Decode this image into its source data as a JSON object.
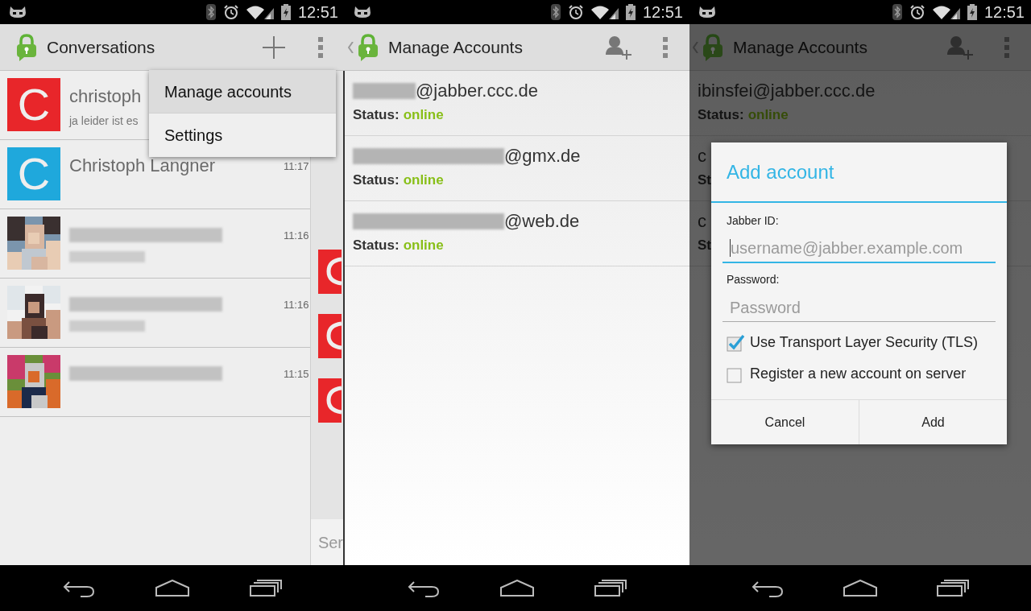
{
  "screens": [
    {
      "status_bar": {
        "time": "12:51"
      },
      "action_bar": {
        "up_caret": false,
        "title": "Conversations",
        "actions": [
          {
            "kind": "plus"
          },
          {
            "kind": "overflow"
          }
        ]
      },
      "conversations": [
        {
          "kind": "letter",
          "letter": "C",
          "color": "#e8262a",
          "name": "christoph",
          "preview": "ja leider ist es"
        },
        {
          "kind": "letter",
          "letter": "C",
          "color": "#1fa8dc",
          "name": "Christoph Langner",
          "time": "11:17"
        },
        {
          "kind": "blurred",
          "preview_blurred": true,
          "time": "11:16"
        },
        {
          "kind": "blurred",
          "preview_blurred": true,
          "time": "11:16"
        },
        {
          "kind": "blurred",
          "preview_blurred": false,
          "time": "11:15"
        }
      ],
      "menu": [
        {
          "label": "Manage accounts",
          "selected": true
        },
        {
          "label": "Settings",
          "selected": false
        }
      ],
      "side_pane": {
        "tiles": [
          {
            "color": "#e8262a"
          },
          {
            "color": "#e8262a"
          },
          {
            "color": "#e8262a"
          }
        ],
        "message_hint": "Ser"
      }
    },
    {
      "status_bar": {
        "time": "12:51"
      },
      "action_bar": {
        "up_caret": true,
        "title": "Manage Accounts",
        "actions": [
          {
            "kind": "add_person"
          },
          {
            "kind": "overflow"
          }
        ]
      },
      "accounts": [
        {
          "kind": "short_blur",
          "address": "@jabber.ccc.de",
          "status_label": "Status:",
          "status": "online"
        },
        {
          "kind": "long_blur",
          "address": "@gmx.de",
          "status_label": "Status:",
          "status": "online"
        },
        {
          "kind": "long_blur",
          "address": "@web.de",
          "status_label": "Status:",
          "status": "online"
        }
      ]
    },
    {
      "status_bar": {
        "time": "12:51"
      },
      "action_bar": {
        "up_caret": true,
        "title": "Manage Accounts",
        "actions": [
          {
            "kind": "add_person"
          },
          {
            "kind": "overflow"
          }
        ]
      },
      "dimmed": true,
      "accounts": [
        {
          "kind": "plain",
          "address": "ibinsfei@jabber.ccc.de",
          "status_label": "Status:",
          "status": "online"
        },
        {
          "kind": "plain",
          "address": "c",
          "status_label": "St"
        },
        {
          "kind": "plain",
          "address": "c",
          "status_label": "St"
        }
      ],
      "dialog": {
        "title": "Add account",
        "fields": [
          {
            "label": "Jabber ID:",
            "placeholder": "username@jabber.example.com",
            "focused": true
          },
          {
            "label": "Password:",
            "placeholder": "Password",
            "focused": false
          }
        ],
        "checkboxes": [
          {
            "label": "Use Transport Layer Security (TLS)",
            "checked": true
          },
          {
            "label": "Register a new account on server",
            "checked": false
          }
        ],
        "buttons": [
          "Cancel",
          "Add"
        ]
      }
    }
  ]
}
